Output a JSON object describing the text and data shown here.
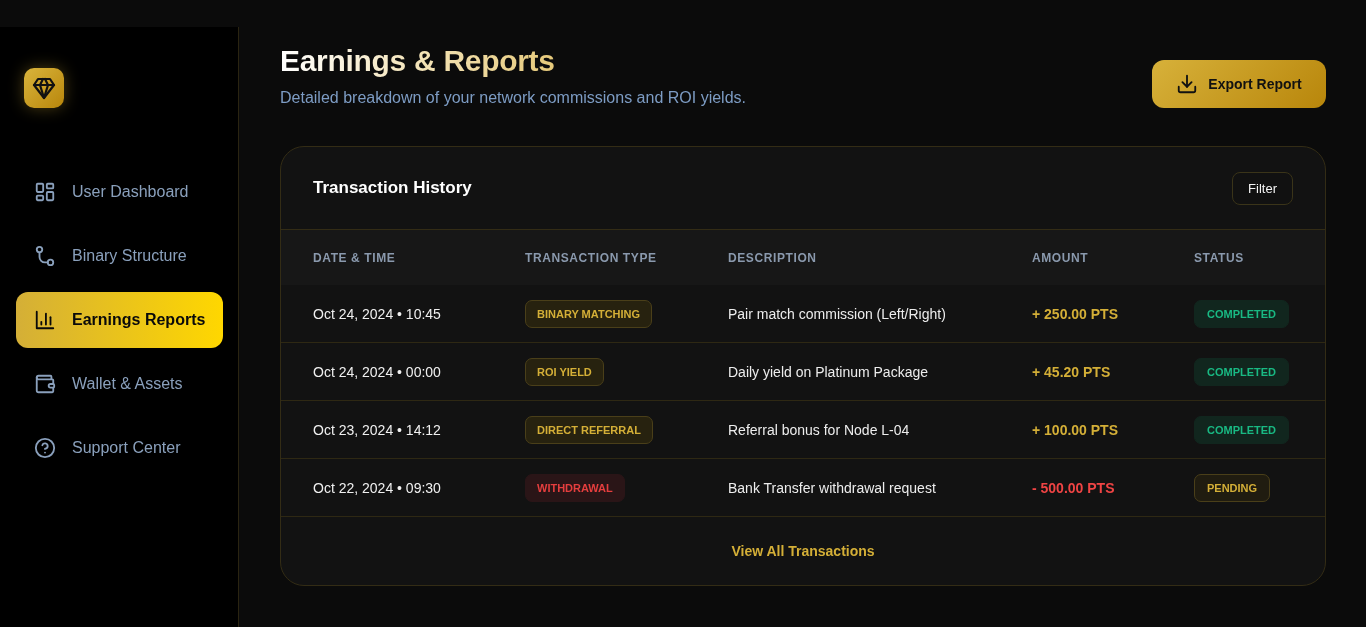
{
  "sidebar": {
    "items": [
      {
        "label": "User Dashboard",
        "selected": false
      },
      {
        "label": "Binary Structure",
        "selected": false
      },
      {
        "label": "Earnings Reports",
        "selected": true
      },
      {
        "label": "Wallet & Assets",
        "selected": false
      },
      {
        "label": "Support Center",
        "selected": false
      }
    ]
  },
  "header": {
    "title": "Earnings & Reports",
    "subtitle": "Detailed breakdown of your network commissions and ROI yields.",
    "export_button": "Export Report"
  },
  "transactions": {
    "title": "Transaction History",
    "filter_button": "Filter",
    "columns": [
      "DATE & TIME",
      "TRANSACTION TYPE",
      "DESCRIPTION",
      "AMOUNT",
      "STATUS"
    ],
    "rows": [
      {
        "date": "Oct 24, 2024 • 10:45",
        "type": "BINARY MATCHING",
        "description": "Pair match commission (Left/Right)",
        "amount": "+ 250.00 PTS",
        "kind": "credit",
        "status": {
          "label": "COMPLETED",
          "kind": "completed"
        }
      },
      {
        "date": "Oct 24, 2024 • 00:00",
        "type": "ROI YIELD",
        "description": "Daily yield on Platinum Package",
        "amount": "+ 45.20 PTS",
        "kind": "credit",
        "status": {
          "label": "COMPLETED",
          "kind": "completed"
        }
      },
      {
        "date": "Oct 23, 2024 • 14:12",
        "type": "DIRECT REFERRAL",
        "description": "Referral bonus for Node L-04",
        "amount": "+ 100.00 PTS",
        "kind": "credit",
        "status": {
          "label": "COMPLETED",
          "kind": "completed"
        }
      },
      {
        "date": "Oct 22, 2024 • 09:30",
        "type": "WITHDRAWAL",
        "description": "Bank Transfer withdrawal request",
        "amount": "- 500.00 PTS",
        "kind": "debit",
        "status": {
          "label": "PENDING",
          "kind": "pending"
        }
      }
    ],
    "footer_link": "View All Transactions"
  }
}
